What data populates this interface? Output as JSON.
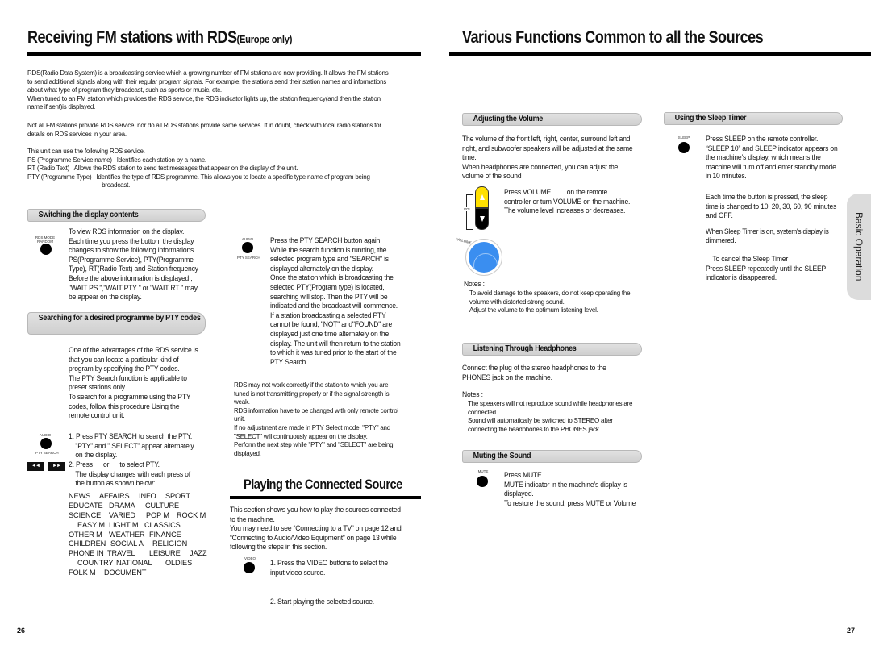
{
  "left_page": {
    "title": "Receiving FM stations with RDS",
    "title_suffix": "(Europe only)",
    "intro": [
      "RDS(Radio Data System) is a broadcasting service which a growing number of FM stations are now providing. It allows the FM stations",
      "to send additional signals along with their regular program signals. For example, the stations send their station names and informations",
      "about what type of program they broadcast, such as sports or music, etc.",
      "When tuned to an FM station which provides the RDS service, the RDS indicator lights up, the station frequency(and then the station",
      "name if sent)is displayed."
    ],
    "note": [
      "Not all FM stations provide RDS service, nor do all RDS stations provide same services. If in doubt, check with local radio stations for",
      "details on RDS services in your area."
    ],
    "services_intro": "This unit can use the following RDS service.",
    "services": [
      {
        "term": "PS (Programme Service name)",
        "desc": "Identifies each station by a name."
      },
      {
        "term": "RT (Radio Text)",
        "desc": "Allows the RDS station to send text messages that appear on the display of the unit."
      },
      {
        "term": "PTY (Programme Type)",
        "desc": "Identifies the type of RDS programme. This allows you to locate a specific type name of program being",
        "desc2": "broadcast."
      }
    ],
    "switching": {
      "heading": "Switching the display contents",
      "button_label": "RDS MODE\nRANDOM",
      "lines": [
        "To view RDS information on the display.",
        "Each time you press the button, the display",
        "changes to show the following informations.",
        "PS(Programme Service), PTY(Programme",
        "Type), RT(Radio Text) and Station frequency",
        "Before the above information is displayed ,",
        "\"WAIT PS \",\"WAIT PTY \" or \"WAIT RT \" may",
        "be appear on the display."
      ]
    },
    "searching": {
      "heading": "Searching for a desired programme by PTY codes",
      "lines": [
        "One of the advantages of the RDS service is",
        "that you can locate a particular kind of",
        "program by specifying the PTY codes.",
        "The PTY Search function is applicable to",
        "preset stations only.",
        "To search for a programme using the PTY",
        "codes, follow this procedure Using the",
        "remote  control unit."
      ],
      "audio_label": "AUDIO",
      "pty_search_label": "PTY SEARCH",
      "step1": [
        "1. Press PTY SEARCH to search the  PTY.",
        "\"PTY\" and \" SELECT\" appear alternately",
        "on the display."
      ],
      "skip_back_glyph": "◄◄",
      "skip_fwd_glyph": "►►",
      "step2": [
        "2. Press      or      to select PTY.",
        "The display changes with each press of",
        "the button as shown below:"
      ],
      "pty_codes": [
        [
          "NEWS",
          "AFFAIRS",
          "INFO",
          "SPORT"
        ],
        [
          "EDUCATE",
          "DRAMA",
          "CULTURE"
        ],
        [
          "SCIENCE",
          "VARIED",
          "POP M",
          "ROCK M"
        ],
        [
          "EASY M",
          "LIGHT M",
          "CLASSICS"
        ],
        [
          "OTHER M",
          "WEATHER",
          "FINANCE"
        ],
        [
          "CHILDREN",
          "SOCIAL A",
          "RELIGION"
        ],
        [
          "PHONE IN",
          "TRAVEL",
          "LEISURE",
          "JAZZ"
        ],
        [
          "COUNTRY",
          "NATIONAL",
          "OLDIES"
        ],
        [
          "FOLK M",
          "DOCUMENT"
        ]
      ]
    },
    "pty_again": {
      "audio_label": "AUDIO",
      "pty_search_label": "PTY SEARCH",
      "lines": [
        "Press the PTY SEARCH button again",
        "While the search function is running, the",
        "selected program type and \"SEARCH\" is",
        "displayed alternately on the display.",
        "Once the station which is broadcasting the",
        "selected PTY(Program type) is located,",
        "searching will stop.  Then the PTY will be",
        "indicated and the broadcast will commence.",
        "If a station broadcasting a selected PTY",
        "cannot be found, \"NOT\" and\"FOUND\" are",
        "displayed just one time alternately on the",
        "display. The unit will then return to the station",
        "to which it was tuned prior to the start of the",
        "PTY Search."
      ]
    },
    "rds_notes": [
      "RDS may not work correctly if the station to which you are",
      "tuned is not transmitting properly or if  the signal  strength is",
      "weak.",
      "RDS information have to be changed with only remote control",
      "unit.",
      "If no adjustment are made in PTY Select mode, \"PTY\" and",
      "\"SELECT\" will continuously appear on the display.",
      "Perform the next step while \"PTY\" and  \"SELECT\" are being",
      "displayed."
    ],
    "connected": {
      "title": "Playing the Connected Source",
      "lines": [
        "This section shows you how to play the sources connected",
        "to the machine.",
        "You may need to see “Connecting to a TV” on page 12 and",
        "“Connecting to Audio/Video Equipment” on page 13 while",
        "following the steps in this section."
      ],
      "video_label": "VIDEO",
      "step1": [
        "1. Press the VIDEO buttons to select the",
        "input video source."
      ],
      "step2": "2. Start playing the selected source."
    },
    "page_number": "26"
  },
  "right_page": {
    "title": "Various Functions Common to all the Sources",
    "volume": {
      "heading": "Adjusting the Volume",
      "lines": [
        "The volume of the front left, right, center, surround left and",
        "right, and subwoofer speakers will be adjusted at the same",
        "time.",
        "When headphones are connected, you can adjust the",
        "volume of the sound"
      ],
      "vol_label": "VOL.",
      "knob_label": "VOLUME",
      "instructions": [
        "Press VOLUME         on the remote",
        "controller or turn VOLUME on the machine.",
        "The volume level increases or decreases."
      ],
      "notes_label": "Notes :",
      "notes": [
        "To avoid damage to the speakers, do not keep operating the",
        "volume with distorted strong sound.",
        "Adjust the volume to the optimum listening level."
      ],
      "colors": {
        "up_button": "#ffe000",
        "knob": "#3a8ef0"
      }
    },
    "headphones": {
      "heading": "Listening Through Headphones",
      "lines": [
        "Connect the plug of the stereo headphones to the",
        "PHONES jack on the machine."
      ],
      "notes_label": "Notes :",
      "notes": [
        "The speakers will not reproduce sound while headphones are",
        "connected.",
        "Sound will automatically be switched to STEREO after",
        "connecting the headphones to the PHONES jack."
      ]
    },
    "mute": {
      "heading": "Muting the Sound",
      "button_label": "MUTE",
      "lines": [
        "Press MUTE.",
        "MUTE indicator in the machine’s display is",
        "displayed.",
        "To restore the sound, press MUTE or Volume",
        "      ."
      ]
    },
    "sleep": {
      "heading": "Using the Sleep Timer",
      "button_label": "SLEEP",
      "lines1": [
        "Press SLEEP on the remote controller.",
        "“SLEEP 10” and SLEEP indicator appears on",
        "the machine’s display, which means the",
        "machine will turn off and enter standby mode",
        "in 10 minutes."
      ],
      "lines2": [
        "Each time the button is pressed, the sleep",
        "time is changed to 10, 20, 30, 60, 90 minutes",
        "and OFF."
      ],
      "lines3": [
        "When Sleep Timer is on, system's display is",
        "dimmered."
      ],
      "cancel_title": "To cancel the Sleep Timer",
      "cancel_lines": [
        "Press SLEEP repeatedly until the SLEEP",
        "indicator is disappeared."
      ]
    },
    "side_tab": "Basic Operation",
    "page_number": "27"
  }
}
